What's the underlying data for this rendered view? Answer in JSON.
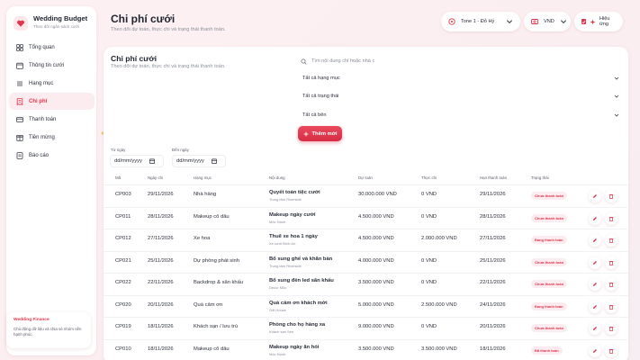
{
  "brand": {
    "title": "Wedding Budget",
    "subtitle": "Theo dõi ngân sách cưới"
  },
  "nav": [
    {
      "label": "Tổng quan",
      "icon": "grid-icon"
    },
    {
      "label": "Thông tin cưới",
      "icon": "calendar-icon"
    },
    {
      "label": "Hạng mục",
      "icon": "list-icon"
    },
    {
      "label": "Chi phí",
      "icon": "receipt-icon",
      "active": true
    },
    {
      "label": "Thanh toán",
      "icon": "card-icon"
    },
    {
      "label": "Tiền mừng",
      "icon": "gift-icon"
    },
    {
      "label": "Báo cáo",
      "icon": "report-icon"
    }
  ],
  "promo": {
    "title": "Wedding Finance",
    "text": "Chủ động dữ liệu và chia sẻ nhóm nền hạnh phúc."
  },
  "header": {
    "title": "Chi phí cưới",
    "subtitle": "Theo dõi dự toán, thực chi và trạng thái thanh toán.",
    "theme_label": "Tone 1 - Đỏ Hỷ",
    "currency_label": "VND",
    "effects_label": "Hiệu ứng"
  },
  "card": {
    "title": "Chi phí cưới",
    "subtitle": "Theo dõi dự toán, thực chi và trạng thái thanh toán.",
    "search_placeholder": "Tìm nội dung chi hoặc nhà c",
    "filter_category": "Tất cả hạng mục",
    "filter_status": "Tất cả trạng thái",
    "filter_party": "Tất cả bên",
    "add_label": "Thêm mới",
    "from_label": "Từ ngày",
    "to_label": "Đến ngày",
    "date_placeholder": "dd/mm/yyyy"
  },
  "table": {
    "columns": [
      "Mã",
      "Ngày chi",
      "Hạng mục",
      "Nội dung",
      "Dự toán",
      "Thực chi",
      "Hạn thanh toán",
      "Trạng thái"
    ],
    "rows": [
      {
        "code": "CP003",
        "date": "29/11/2026",
        "category": "Nhà hàng",
        "title": "Quyết toán tiệc cưới",
        "sub": "Trung tâm Riverside",
        "estimate": "30.000.000 VND",
        "actual": "0 VND",
        "due": "29/11/2026",
        "status": "Chưa thanh toán"
      },
      {
        "code": "CP011",
        "date": "28/11/2026",
        "category": "Makeup cô dâu",
        "title": "Makeup ngày cưới",
        "sub": "Mộc Hạnh",
        "estimate": "4.500.000 VND",
        "actual": "0 VND",
        "due": "28/11/2026",
        "status": "Chưa thanh toán"
      },
      {
        "code": "CP012",
        "date": "27/11/2026",
        "category": "Xe hoa",
        "title": "Thuê xe hoa 1 ngày",
        "sub": "Xe cưới Bình An",
        "estimate": "4.500.000 VND",
        "actual": "2.000.000 VND",
        "due": "27/11/2026",
        "status": "Đang thanh toán"
      },
      {
        "code": "CP021",
        "date": "25/11/2026",
        "category": "Dự phòng phát sinh",
        "title": "Bổ sung ghế và khăn bàn",
        "sub": "Trung tâm Riverside",
        "estimate": "4.000.000 VND",
        "actual": "0 VND",
        "due": "25/11/2026",
        "status": "Chưa thanh toán"
      },
      {
        "code": "CP022",
        "date": "22/11/2026",
        "category": "Backdrop & sân khấu",
        "title": "Bổ sung đèn led sân khấu",
        "sub": "Decor Mộc",
        "estimate": "3.500.000 VND",
        "actual": "0 VND",
        "due": "22/11/2026",
        "status": "Chưa thanh toán"
      },
      {
        "code": "CP020",
        "date": "20/11/2026",
        "category": "Quà cảm ơn",
        "title": "Quà cảm ơn khách mời",
        "sub": "Gift House",
        "estimate": "5.000.000 VND",
        "actual": "2.500.000 VND",
        "due": "24/11/2026",
        "status": "Đang thanh toán"
      },
      {
        "code": "CP019",
        "date": "18/11/2026",
        "category": "Khách sạn / lưu trú",
        "title": "Phòng cho họ hàng xa",
        "sub": "Khách sạn Sen",
        "estimate": "9.000.000 VND",
        "actual": "0 VND",
        "due": "20/11/2026",
        "status": "Chưa thanh toán"
      },
      {
        "code": "CP010",
        "date": "18/11/2026",
        "category": "Makeup cô dâu",
        "title": "Makeup ngày ăn hỏi",
        "sub": "Mộc Hạnh",
        "estimate": "3.500.000 VND",
        "actual": "3.500.000 VND",
        "due": "18/11/2026",
        "status": "Đã thanh toán"
      }
    ]
  },
  "colors": {
    "accent": "#e0364d",
    "accent_soft": "#fdecef",
    "background": "#fdf1f3"
  }
}
